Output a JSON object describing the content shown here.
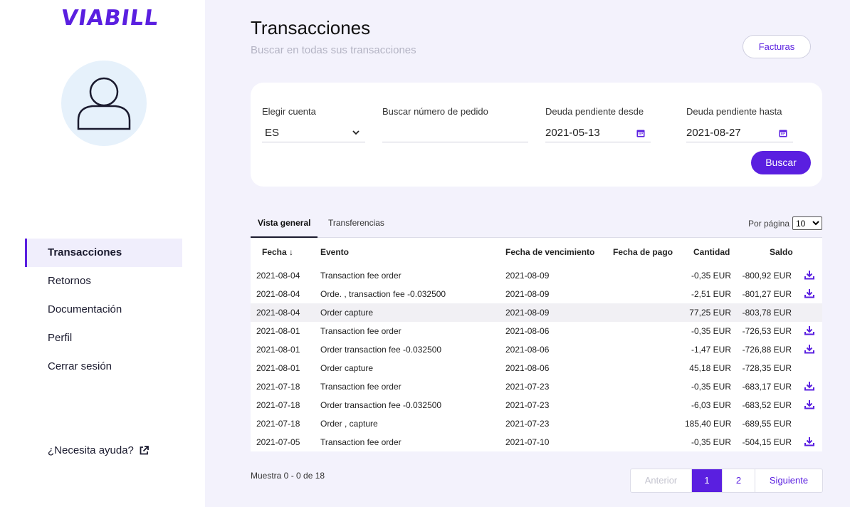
{
  "brand": {
    "logo": "VIABILL",
    "accent": "#5a1fe0"
  },
  "sidebar": {
    "items": [
      {
        "label": "Transacciones",
        "active": true
      },
      {
        "label": "Retornos"
      },
      {
        "label": "Documentación"
      },
      {
        "label": "Perfil"
      },
      {
        "label": "Cerrar sesión"
      }
    ],
    "help": "¿Necesita ayuda?"
  },
  "header": {
    "title": "Transacciones",
    "subtitle": "Buscar en todas sus transacciones",
    "facturas_label": "Facturas"
  },
  "filters": {
    "account_label": "Elegir cuenta",
    "account_value": "ES",
    "order_label": "Buscar número de pedido",
    "order_value": "",
    "from_label": "Deuda pendiente desde",
    "from_value": "2021-05-13",
    "to_label": "Deuda pendiente hasta",
    "to_value": "2021-08-27",
    "search_label": "Buscar"
  },
  "tabs": [
    {
      "label": "Vista general",
      "active": true
    },
    {
      "label": "Transferencias"
    }
  ],
  "per_page": {
    "label": "Por página",
    "value": "10"
  },
  "table": {
    "headers": {
      "date": "Fecha",
      "event": "Evento",
      "due": "Fecha de vencimiento",
      "paid": "Fecha de pago",
      "amount": "Cantidad",
      "balance": "Saldo"
    },
    "rows": [
      {
        "date": "2021-08-04",
        "event": "Transaction fee order",
        "due": "2021-08-09",
        "amount": "-0,35 EUR",
        "balance": "-800,92 EUR",
        "download": true
      },
      {
        "date": "2021-08-04",
        "event": "Orde.          , transaction fee -0.032500",
        "due": "2021-08-09",
        "amount": "-2,51 EUR",
        "balance": "-801,27 EUR",
        "download": true
      },
      {
        "date": "2021-08-04",
        "event": "Order             capture",
        "due": "2021-08-09",
        "amount": "77,25 EUR",
        "balance": "-803,78 EUR",
        "download": false,
        "highlight": true
      },
      {
        "date": "2021-08-01",
        "event": "Transaction fee order",
        "due": "2021-08-06",
        "amount": "-0,35 EUR",
        "balance": "-726,53 EUR",
        "download": true
      },
      {
        "date": "2021-08-01",
        "event": "Order            transaction fee -0.032500",
        "due": "2021-08-06",
        "amount": "-1,47 EUR",
        "balance": "-726,88 EUR",
        "download": true
      },
      {
        "date": "2021-08-01",
        "event": "Order          capture",
        "due": "2021-08-06",
        "amount": "45,18 EUR",
        "balance": "-728,35 EUR",
        "download": false
      },
      {
        "date": "2021-07-18",
        "event": "Transaction fee order",
        "due": "2021-07-23",
        "amount": "-0,35 EUR",
        "balance": "-683,17 EUR",
        "download": true
      },
      {
        "date": "2021-07-18",
        "event": "Order            transaction fee -0.032500",
        "due": "2021-07-23",
        "amount": "-6,03 EUR",
        "balance": "-683,52 EUR",
        "download": true
      },
      {
        "date": "2021-07-18",
        "event": "Order           , capture",
        "due": "2021-07-23",
        "amount": "185,40 EUR",
        "balance": "-689,55 EUR",
        "download": false
      },
      {
        "date": "2021-07-05",
        "event": "Transaction fee order",
        "due": "2021-07-10",
        "amount": "-0,35 EUR",
        "balance": "-504,15 EUR",
        "download": true
      }
    ]
  },
  "footer": {
    "showing": "Muestra 0 - 0 de 18",
    "prev": "Anterior",
    "page1": "1",
    "page2": "2",
    "next": "Siguiente"
  }
}
